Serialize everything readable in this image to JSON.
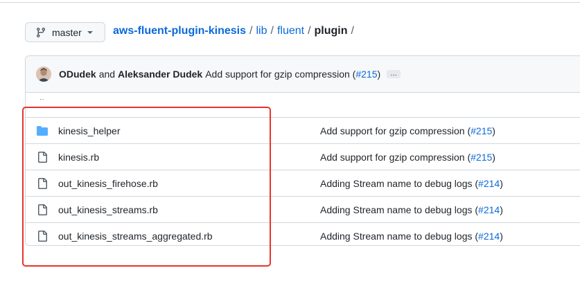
{
  "branch": {
    "label": "master",
    "icon": "git-branch-icon"
  },
  "breadcrumb": {
    "repo": "aws-fluent-plugin-kinesis",
    "parts": [
      "lib",
      "fluent"
    ],
    "current": "plugin",
    "separator": "/"
  },
  "latest_commit": {
    "author1": "ODudek",
    "conjunction": "and",
    "author2": "Aleksander Dudek",
    "message": "Add support for gzip compression",
    "pr": "#215",
    "ellipsis": "…"
  },
  "parent_dir": {
    "label": "‥"
  },
  "files": [
    {
      "name": "kinesis_helper",
      "type": "directory",
      "message": "Add support for gzip compression",
      "pr": "#215"
    },
    {
      "name": "kinesis.rb",
      "type": "file",
      "message": "Add support for gzip compression",
      "pr": "#215"
    },
    {
      "name": "out_kinesis_firehose.rb",
      "type": "file",
      "message": "Adding Stream name to debug logs",
      "pr": "#214"
    },
    {
      "name": "out_kinesis_streams.rb",
      "type": "file",
      "message": "Adding Stream name to debug logs",
      "pr": "#214"
    },
    {
      "name": "out_kinesis_streams_aggregated.rb",
      "type": "file",
      "message": "Adding Stream name to debug logs",
      "pr": "#214"
    }
  ],
  "colors": {
    "link": "#0969da",
    "folder": "#54aeff",
    "highlight": "#e8322c"
  }
}
